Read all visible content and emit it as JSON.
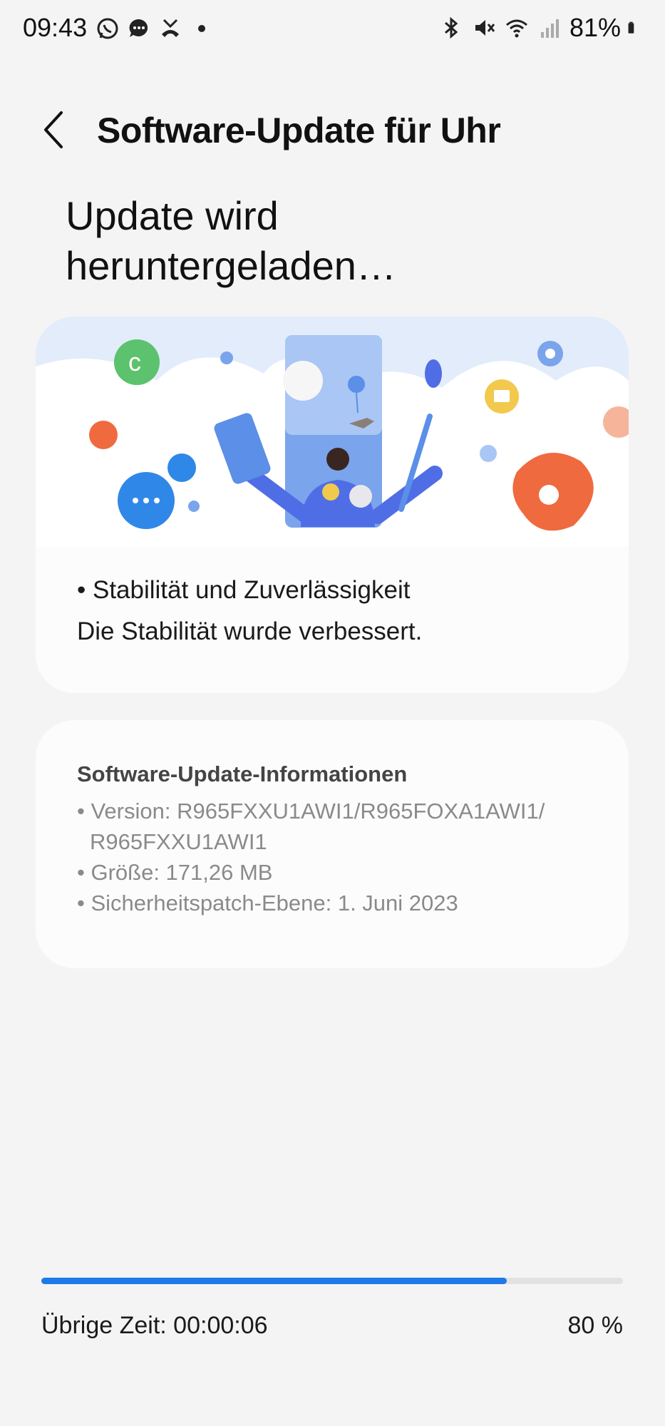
{
  "status_bar": {
    "time": "09:43",
    "battery": "81%",
    "left_icons": [
      "whatsapp-icon",
      "message-icon",
      "missed-call-icon",
      "dot-icon"
    ],
    "right_icons": [
      "bluetooth-icon",
      "mute-icon",
      "wifi-icon",
      "signal-icon",
      "battery-icon"
    ]
  },
  "header": {
    "title": "Software-Update für Uhr"
  },
  "headline": "Update wird heruntergeladen…",
  "changelog": {
    "item": "• Stabilität und Zuverlässigkeit",
    "description": "Die Stabilität wurde verbessert."
  },
  "info": {
    "title": "Software-Update-Informationen",
    "version_line1": "• Version: R965FXXU1AWI1/R965FOXA1AWI1/",
    "version_line2": "R965FXXU1AWI1",
    "size": "• Größe: 171,26 MB",
    "patch": "• Sicherheitspatch-Ebene: 1. Juni 2023"
  },
  "progress": {
    "fraction": 0.8,
    "remaining": "Übrige Zeit: 00:00:06",
    "percent_label": "80 %"
  },
  "colors": {
    "accent": "#1e7ae6",
    "background": "#f4f4f4",
    "card": "#fcfcfc"
  }
}
